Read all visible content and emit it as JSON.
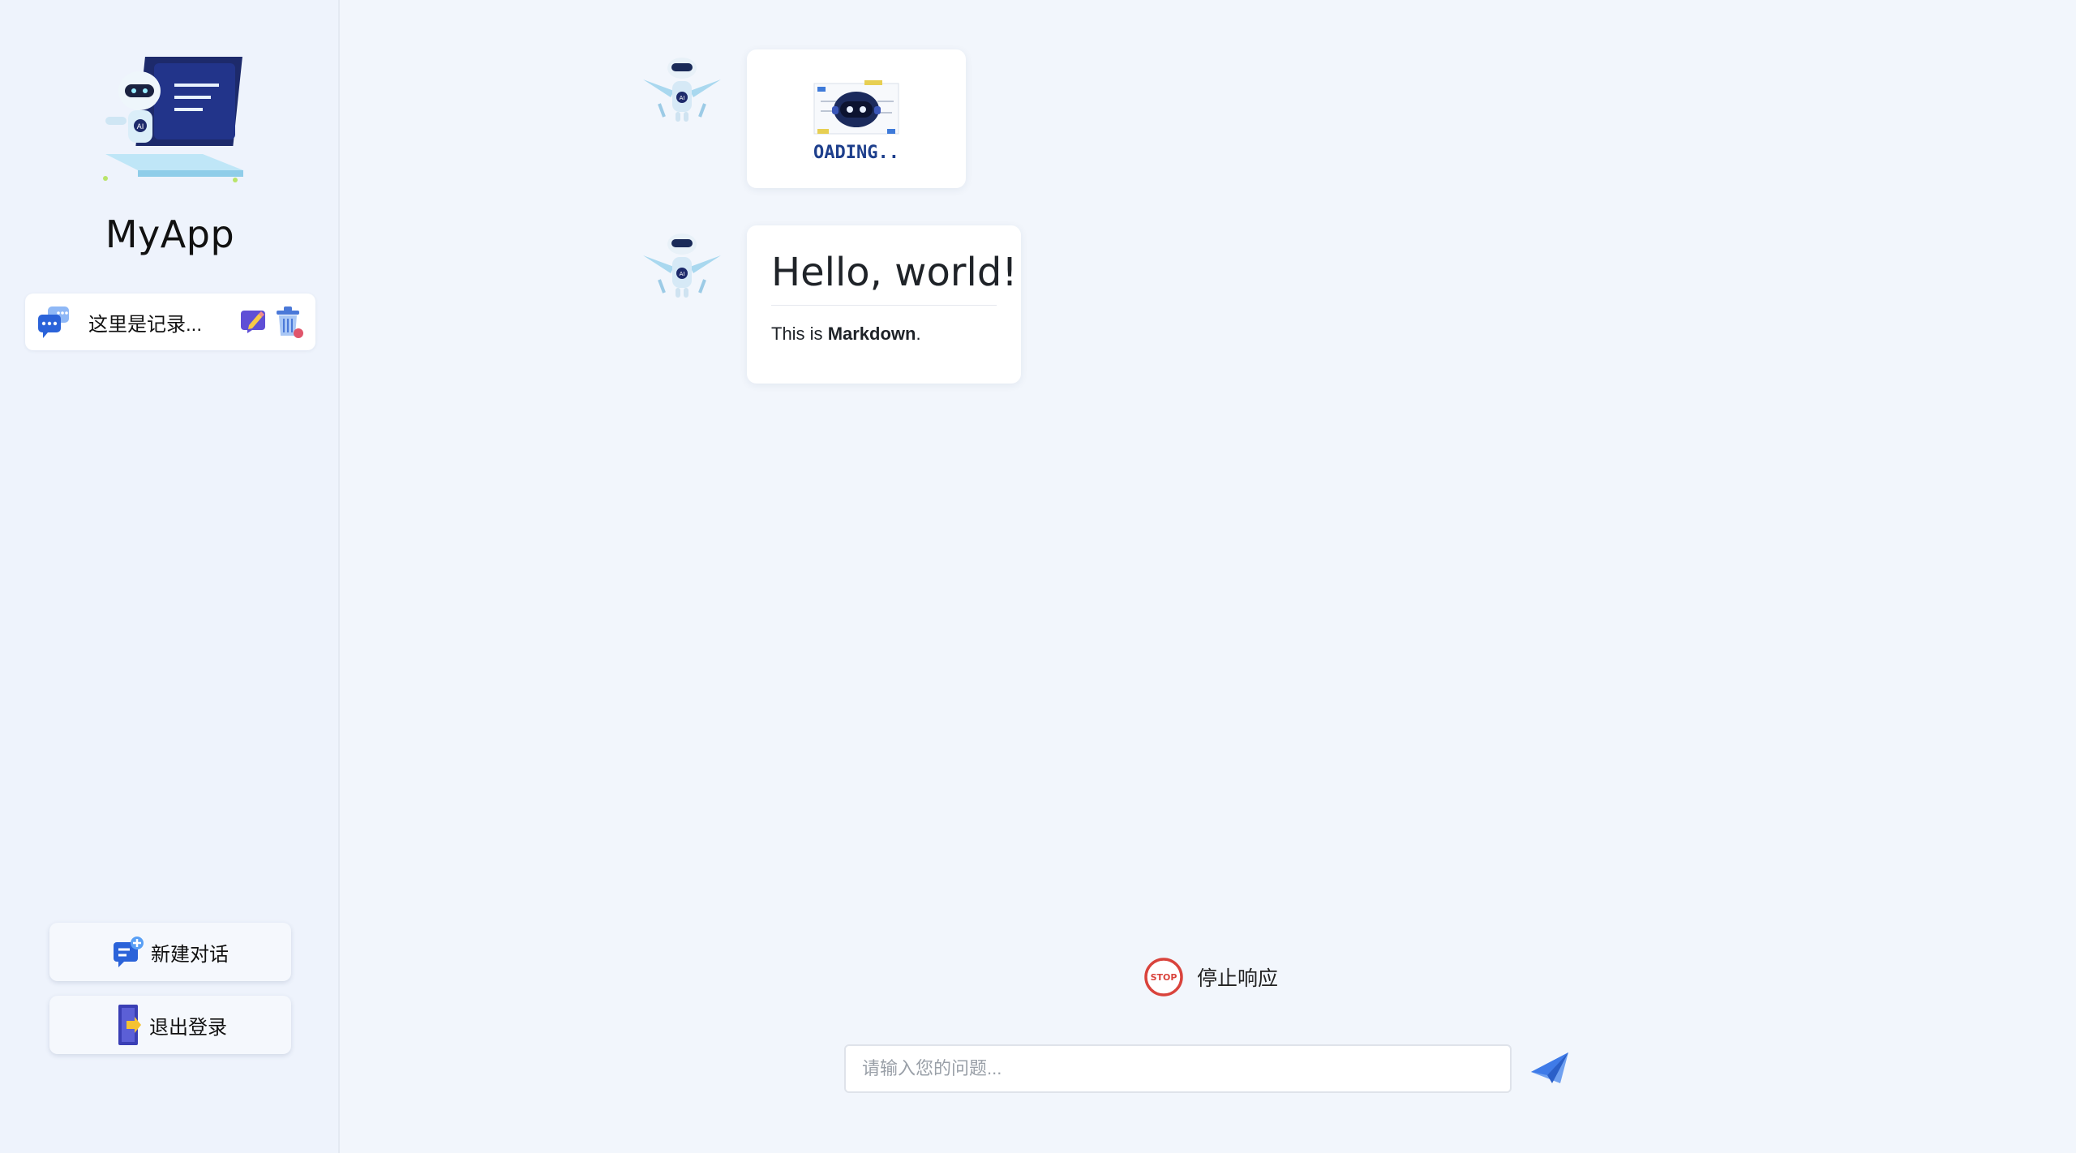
{
  "app": {
    "title": "MyApp"
  },
  "sidebar": {
    "history": [
      {
        "label": "这里是记录..."
      }
    ],
    "new_chat_label": "新建对话",
    "logout_label": "退出登录"
  },
  "chat": {
    "loading_text": "LOADING...",
    "messages": [
      {
        "role": "assistant",
        "type": "loading"
      },
      {
        "role": "assistant",
        "type": "markdown",
        "heading": "Hello, world!",
        "text_prefix": "This is ",
        "text_bold": "Markdown",
        "text_suffix": "."
      }
    ]
  },
  "controls": {
    "stop_badge": "STOP",
    "stop_label": "停止响应",
    "input_placeholder": "请输入您的问题...",
    "input_value": ""
  },
  "colors": {
    "accent": "#3f7be8",
    "stop_red": "#d9433c",
    "background": "#f2f6fc"
  },
  "icons": {
    "logo": "robot-laptop-logo",
    "chat": "chat-bubbles-icon",
    "edit": "edit-icon",
    "trash": "trash-icon",
    "new_chat": "new-chat-icon",
    "logout": "logout-door-icon",
    "avatar": "robot-avatar",
    "stop": "stop-icon",
    "send": "paper-plane-icon"
  }
}
